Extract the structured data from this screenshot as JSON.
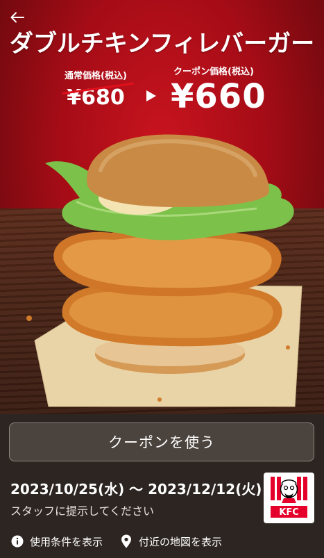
{
  "header": {
    "back_label": "←",
    "title": "ダブルチキンフィレバーガー"
  },
  "pricing": {
    "regular_label": "通常価格(税込)",
    "regular_price": "¥680",
    "coupon_label": "クーポン価格(税込)",
    "coupon_price": "¥660"
  },
  "hero": {
    "image_subject": "double chicken fillet burger"
  },
  "actions": {
    "use_coupon_label": "クーポンを使う"
  },
  "validity": {
    "date_range": "2023/10/25(水) 〜 2023/12/12(火)",
    "staff_note": "スタッフに提示してください"
  },
  "brand": {
    "logo_text": "KFC",
    "logo_icon": "kfc-colonel-logo",
    "accent_color": "#e4002b"
  },
  "footer_links": {
    "terms_label": "使用条件を表示",
    "terms_icon": "info-icon",
    "map_label": "付近の地図を表示",
    "map_icon": "location-pin-icon"
  },
  "colors": {
    "hero_red": "#b50f19",
    "panel_bg": "#2c2521",
    "button_bg": "#4b433e",
    "strike_red": "#e0101c"
  }
}
